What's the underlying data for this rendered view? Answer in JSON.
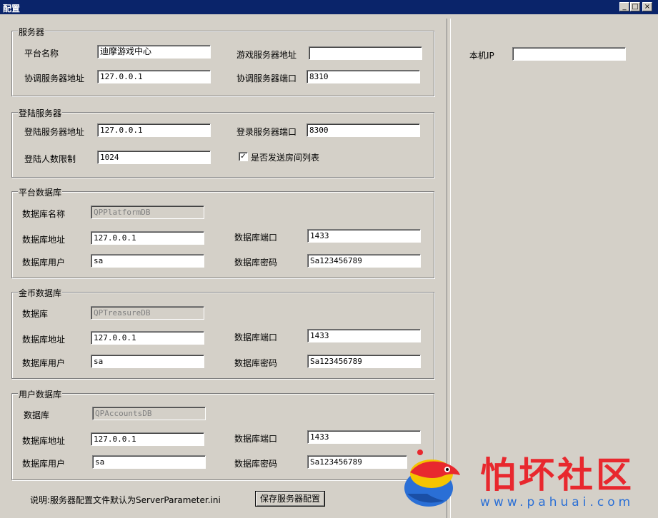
{
  "window": {
    "title": "配置",
    "minimize_glyph": "_",
    "maximize_glyph": "□",
    "close_glyph": "×"
  },
  "server": {
    "group_title": "服务器",
    "platform_name_label": "平台名称",
    "platform_name_value": "迪摩游戏中心",
    "game_server_address_label": "游戏服务器地址",
    "game_server_address_value": "",
    "coord_server_address_label": "协调服务器地址",
    "coord_server_address_value": "127.0.0.1",
    "coord_server_port_label": "协调服务器端口",
    "coord_server_port_value": "8310"
  },
  "login": {
    "group_title": "登陆服务器",
    "login_server_address_label": "登陆服务器地址",
    "login_server_address_value": "127.0.0.1",
    "login_server_port_label": "登录服务器端口",
    "login_server_port_value": "8300",
    "login_limit_label": "登陆人数限制",
    "login_limit_value": "1024",
    "send_room_list_label": "是否发送房间列表",
    "send_room_list_checked": "✓"
  },
  "platform_db": {
    "group_title": "平台数据库",
    "db_name_label": "数据库名称",
    "db_name_value": "QPPlatformDB",
    "address_label": "数据库地址",
    "address_value": "127.0.0.1",
    "port_label": "数据库端口",
    "port_value": "1433",
    "user_label": "数据库用户",
    "user_value": "sa",
    "password_label": "数据库密码",
    "password_value": "Sa123456789"
  },
  "treasure_db": {
    "group_title": "金币数据库",
    "db_name_label": "数据库",
    "db_name_value": "QPTreasureDB",
    "address_label": "数据库地址",
    "address_value": "127.0.0.1",
    "port_label": "数据库端口",
    "port_value": "1433",
    "user_label": "数据库用户",
    "user_value": "sa",
    "password_label": "数据库密码",
    "password_value": "Sa123456789"
  },
  "accounts_db": {
    "group_title": "用户数据库",
    "db_name_label": "数据库",
    "db_name_value": "QPAccountsDB",
    "address_label": "数据库地址",
    "address_value": "127.0.0.1",
    "port_label": "数据库端口",
    "port_value": "1433",
    "user_label": "数据库用户",
    "user_value": "sa",
    "password_label": "数据库密码",
    "password_value": "Sa123456789"
  },
  "footer": {
    "note": "说明:服务器配置文件默认为ServerParameter.ini",
    "save_button_label": "保存服务器配置"
  },
  "right_panel": {
    "local_ip_label": "本机IP",
    "local_ip_value": ""
  },
  "watermark": {
    "text": "怕坏社区",
    "url": "www.pahuai.com"
  },
  "colors": {
    "titlebar": "#0a246a",
    "face": "#d4d0c8",
    "watermark_red": "#e8282e",
    "watermark_blue": "#2a6fd6"
  }
}
